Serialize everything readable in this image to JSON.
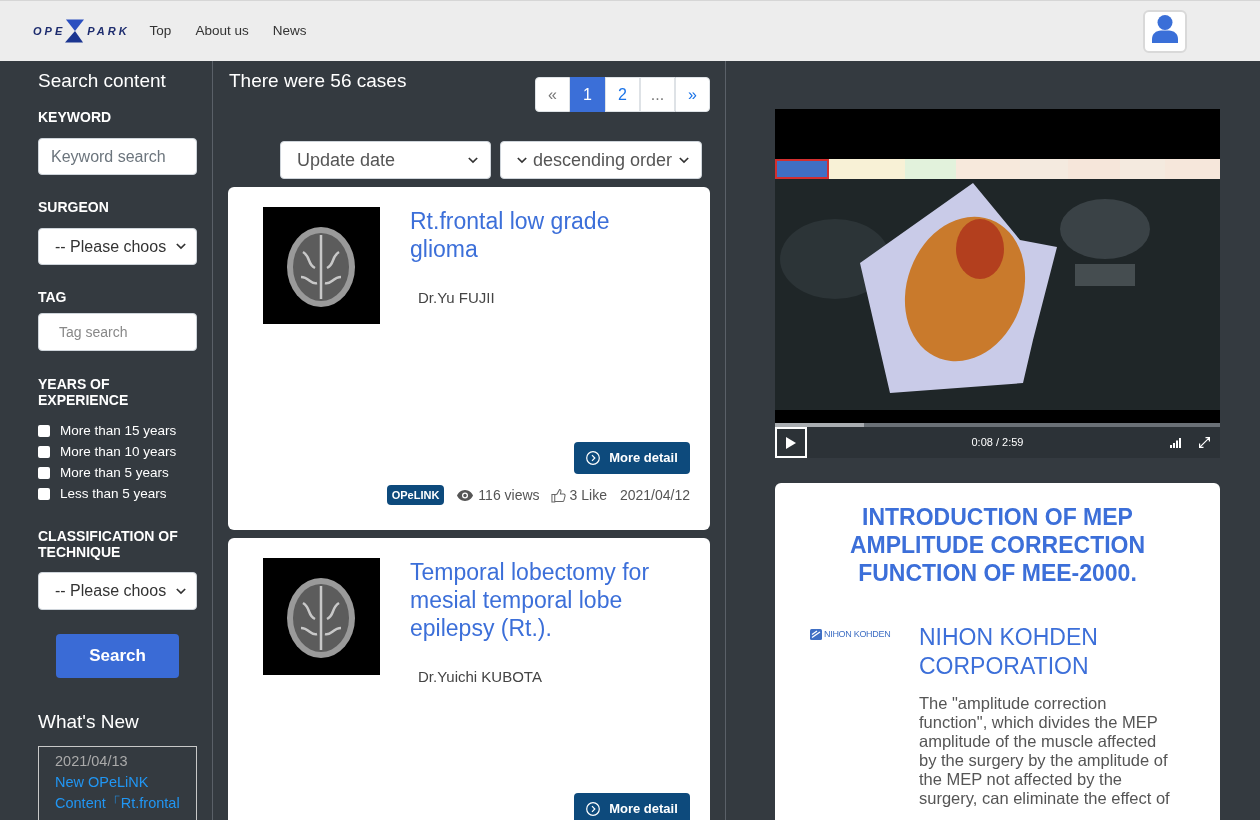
{
  "header": {
    "logo": {
      "left": "OPE",
      "right": "PARK"
    },
    "nav": [
      {
        "label": "Top"
      },
      {
        "label": "About us"
      },
      {
        "label": "News"
      }
    ]
  },
  "sidebar": {
    "title": "Search content",
    "keyword": {
      "label": "KEYWORD",
      "placeholder": "Keyword search"
    },
    "surgeon": {
      "label": "SURGEON",
      "value": "-- Please choos"
    },
    "tag": {
      "label": "TAG",
      "placeholder": "Tag search"
    },
    "experience": {
      "label": "YEARS OF EXPERIENCE",
      "options": [
        {
          "label": "More than 15 years",
          "checked": false
        },
        {
          "label": "More than 10 years",
          "checked": false
        },
        {
          "label": "More than 5 years",
          "checked": false
        },
        {
          "label": "Less than 5 years",
          "checked": false
        }
      ]
    },
    "technique": {
      "label": "CLASSIFICATION OF TECHNIQUE",
      "value": "-- Please choos"
    },
    "search_button": "Search",
    "whats_new": {
      "title": "What's New",
      "items": [
        {
          "date": "2021/04/13",
          "text": "New OPeLiNK Content「Rt.frontal"
        }
      ]
    }
  },
  "results": {
    "summary": "There were 56 cases",
    "pagination": [
      {
        "label": "«",
        "selected": false,
        "disabled": true
      },
      {
        "label": "1",
        "selected": true,
        "disabled": false
      },
      {
        "label": "2",
        "selected": false,
        "disabled": false
      },
      {
        "label": "...",
        "selected": false,
        "disabled": true
      },
      {
        "label": "»",
        "selected": false,
        "disabled": false
      }
    ],
    "sort": {
      "field": "Update date",
      "order": "descending order"
    },
    "cases": [
      {
        "title": "Rt.frontal low grade glioma",
        "author": "Dr.Yu FUJII",
        "button": "More detail",
        "badge": "OPeLINK",
        "views": "116 views",
        "likes": "3 Like",
        "date": "2021/04/12"
      },
      {
        "title": "Temporal lobectomy for mesial temporal lobe epilepsy (Rt.).",
        "author": "Dr.Yuichi KUBOTA",
        "button": "More detail"
      }
    ]
  },
  "video": {
    "time": "0:08 / 2:59",
    "level": 0.2
  },
  "sponsor": {
    "title": "INTRODUCTION OF MEP AMPLITUDE CORRECTION FUNCTION OF MEE-2000.",
    "logo_text": "NIHON KOHDEN",
    "company": "NIHON KOHDEN CORPORATION",
    "description": "The \"amplitude correction function\", which divides the MEP amplitude of the muscle affected by the surgery by the amplitude of the MEP not affected by the surgery, can eliminate the effect of"
  }
}
